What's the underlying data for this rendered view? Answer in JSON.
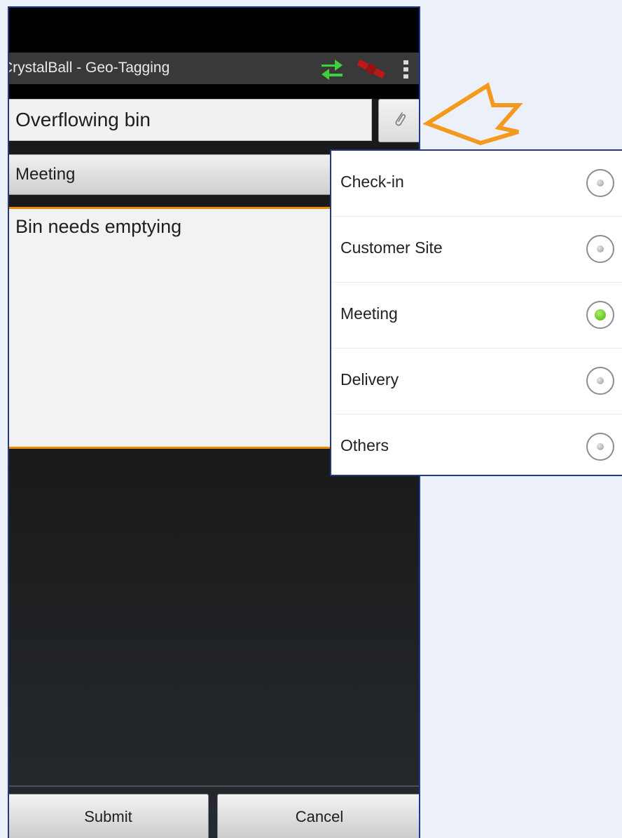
{
  "app": {
    "title": "CrystalBall - Geo-Tagging",
    "icons": [
      "sync-arrows-icon",
      "satellite-icon",
      "overflow-menu-icon"
    ]
  },
  "form": {
    "subject_value": "Overflowing bin",
    "category_selected": "Meeting",
    "description_value": "Bin needs emptying"
  },
  "buttons": {
    "submit_label": "Submit",
    "cancel_label": "Cancel"
  },
  "category_options": [
    {
      "label": "Check-in",
      "selected": false
    },
    {
      "label": "Customer Site",
      "selected": false
    },
    {
      "label": "Meeting",
      "selected": true
    },
    {
      "label": "Delivery",
      "selected": false
    },
    {
      "label": "Others",
      "selected": false
    }
  ],
  "colors": {
    "accent_orange": "#f08a00",
    "sync_green": "#3ed13a",
    "satellite_red": "#c01818",
    "radio_selected_green": "#46b500",
    "frame_blue": "#223a86",
    "callout_arrow": "#f39a1e"
  }
}
